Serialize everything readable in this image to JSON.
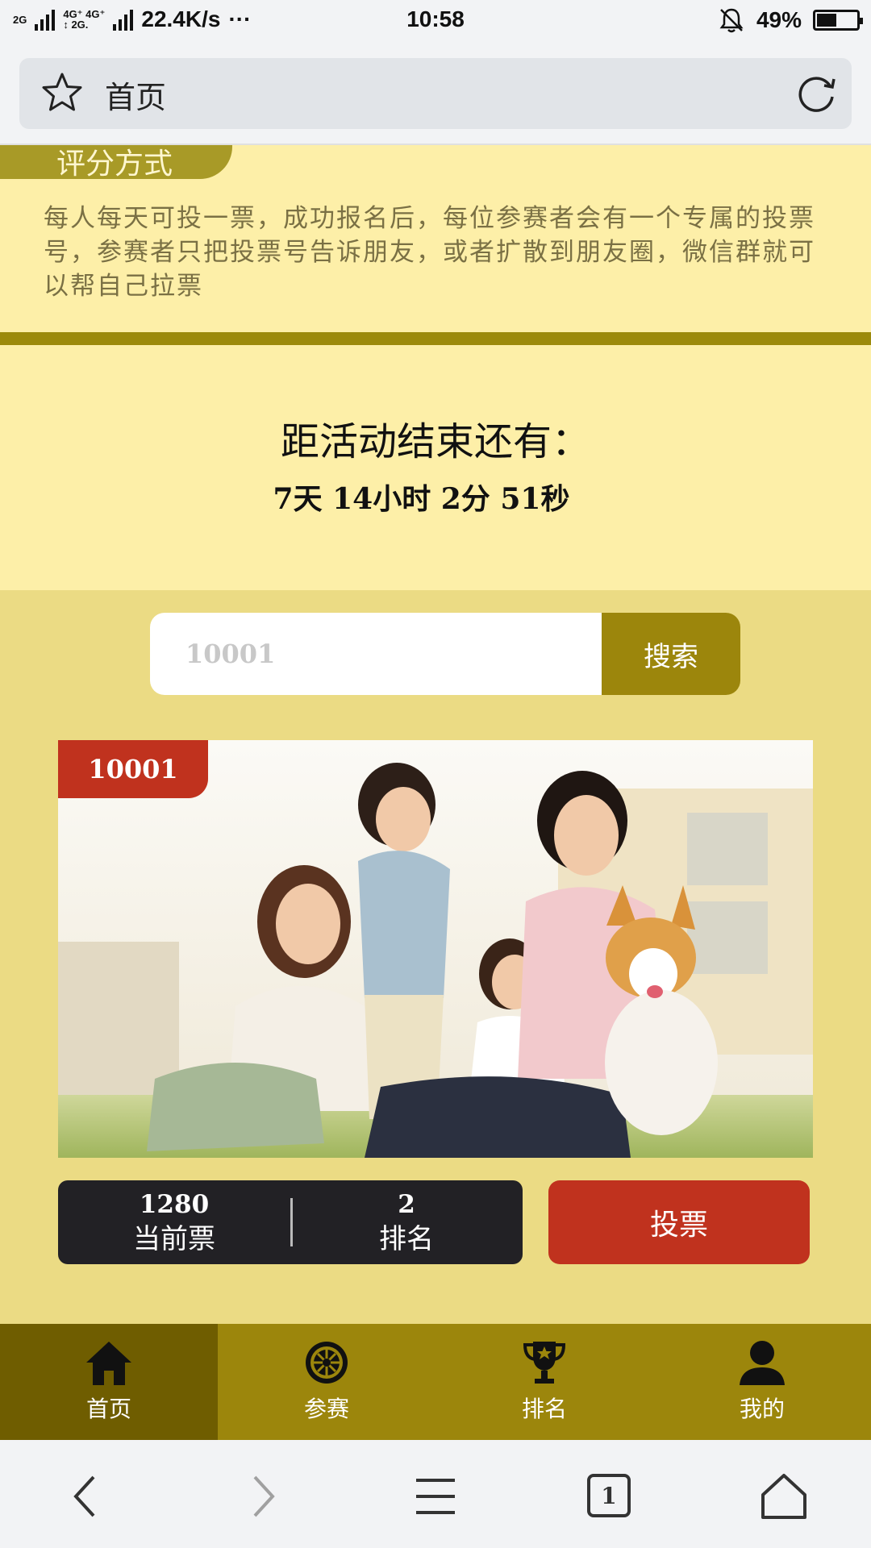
{
  "status_bar": {
    "net1": "2G",
    "net2": "4G⁺ 4G⁺",
    "net3": "↕ 2G.",
    "speed": "22.4K/s",
    "more": "···",
    "time": "10:58",
    "battery": "49%",
    "battery_level": 0.49
  },
  "address_bar": {
    "title": "首页"
  },
  "rules": {
    "tag_label": "评分方式",
    "text": "每人每天可投一票，成功报名后，每位参赛者会有一个专属的投票号，参赛者只把投票号告诉朋友，或者扩散到朋友圈，微信群就可以帮自己拉票"
  },
  "countdown": {
    "heading": "距活动结束还有：",
    "remaining": "7天 14小时 2分 51秒"
  },
  "search": {
    "placeholder": "10001",
    "button_label": "搜索"
  },
  "entry": {
    "id_badge": "10001",
    "votes_value": "1280",
    "votes_label": "当前票",
    "rank_value": "2",
    "rank_label": "排名",
    "vote_button": "投票"
  },
  "tabs": [
    {
      "label": "首页",
      "icon": "home-icon",
      "active": true
    },
    {
      "label": "参赛",
      "icon": "wheel-icon",
      "active": false
    },
    {
      "label": "排名",
      "icon": "trophy-icon",
      "active": false
    },
    {
      "label": "我的",
      "icon": "user-icon",
      "active": false
    }
  ],
  "browser_nav": {
    "tab_count": "1"
  },
  "colors": {
    "gold_dark": "#9c860c",
    "gold_active": "#6f5d00",
    "cream": "#fdefa8",
    "sand": "#ebdb84",
    "red": "#c0321e",
    "dark": "#222125"
  }
}
